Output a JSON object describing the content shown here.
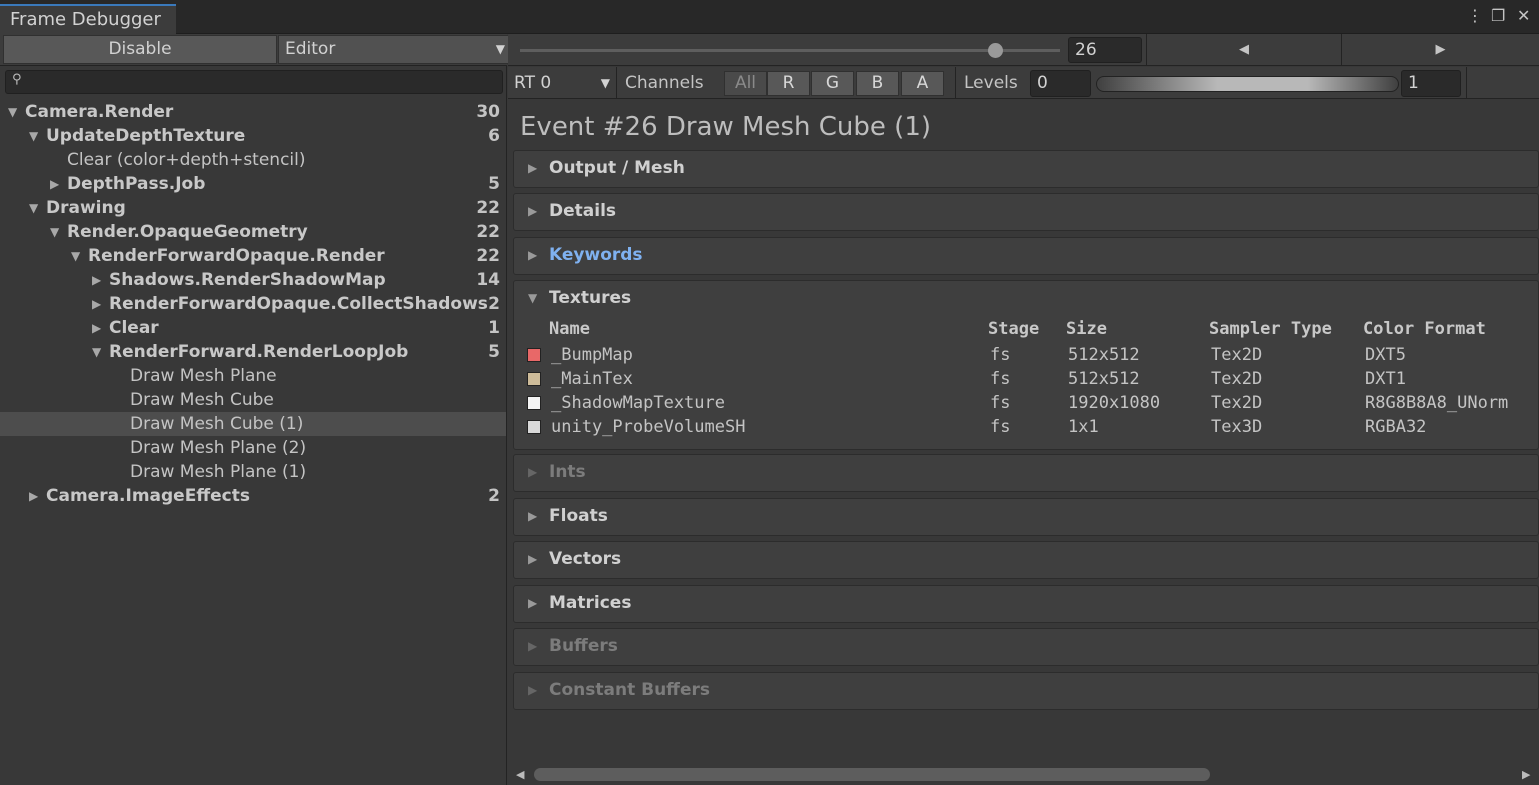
{
  "window": {
    "tab_title": "Frame Debugger",
    "icons": [
      "kebab-menu-icon",
      "maximize-icon",
      "close-icon"
    ],
    "menu_glyph": "⋮",
    "maximize_glyph": "❐",
    "close_glyph": "✕"
  },
  "left_toolbar": {
    "disable_label": "Disable",
    "target_label": "Editor"
  },
  "search": {
    "value": "",
    "icon": "search-icon"
  },
  "tree": [
    {
      "label": "Camera.Render",
      "count": "30",
      "depth": 0,
      "expanded": true,
      "bold": true
    },
    {
      "label": "UpdateDepthTexture",
      "count": "6",
      "depth": 1,
      "expanded": true,
      "bold": true
    },
    {
      "label": "Clear (color+depth+stencil)",
      "count": "",
      "depth": 2,
      "leaf": true
    },
    {
      "label": "DepthPass.Job",
      "count": "5",
      "depth": 2,
      "expanded": false,
      "bold": true
    },
    {
      "label": "Drawing",
      "count": "22",
      "depth": 1,
      "expanded": true,
      "bold": true
    },
    {
      "label": "Render.OpaqueGeometry",
      "count": "22",
      "depth": 2,
      "expanded": true,
      "bold": true
    },
    {
      "label": "RenderForwardOpaque.Render",
      "count": "22",
      "depth": 3,
      "expanded": true,
      "bold": true
    },
    {
      "label": "Shadows.RenderShadowMap",
      "count": "14",
      "depth": 4,
      "expanded": false,
      "bold": true
    },
    {
      "label": "RenderForwardOpaque.CollectShadows",
      "count": "2",
      "depth": 4,
      "expanded": false,
      "bold": true
    },
    {
      "label": "Clear",
      "count": "1",
      "depth": 4,
      "expanded": false,
      "bold": true
    },
    {
      "label": "RenderForward.RenderLoopJob",
      "count": "5",
      "depth": 4,
      "expanded": true,
      "bold": true
    },
    {
      "label": "Draw Mesh Plane",
      "count": "",
      "depth": 5,
      "leaf": true
    },
    {
      "label": "Draw Mesh Cube",
      "count": "",
      "depth": 5,
      "leaf": true
    },
    {
      "label": "Draw Mesh Cube (1)",
      "count": "",
      "depth": 5,
      "leaf": true,
      "selected": true
    },
    {
      "label": "Draw Mesh Plane (2)",
      "count": "",
      "depth": 5,
      "leaf": true
    },
    {
      "label": "Draw Mesh Plane (1)",
      "count": "",
      "depth": 5,
      "leaf": true
    },
    {
      "label": "Camera.ImageEffects",
      "count": "2",
      "depth": 1,
      "expanded": false,
      "bold": true
    }
  ],
  "event_nav": {
    "event_index": "26",
    "slider_fraction": 0.88,
    "prev_icon": "prev-event-icon",
    "next_icon": "next-event-icon"
  },
  "render_target": {
    "rt_label": "RT 0",
    "channels_label": "Channels",
    "channels": [
      "All",
      "R",
      "G",
      "B",
      "A"
    ],
    "levels_label": "Levels",
    "level_min": "0",
    "level_max": "1"
  },
  "event_title": "Event #26 Draw Mesh Cube (1)",
  "sections": [
    {
      "title": "Output / Mesh",
      "state": "normal"
    },
    {
      "title": "Details",
      "state": "normal"
    },
    {
      "title": "Keywords",
      "state": "link"
    }
  ],
  "textures": {
    "title": "Textures",
    "headers": [
      "Name",
      "Stage",
      "Size",
      "Sampler Type",
      "Color Format"
    ],
    "rows": [
      {
        "name": "_BumpMap",
        "stage": "fs",
        "size": "512x512",
        "sampler": "Tex2D",
        "format": "DXT5",
        "swatch": "#e86868"
      },
      {
        "name": "_MainTex",
        "stage": "fs",
        "size": "512x512",
        "sampler": "Tex2D",
        "format": "DXT1",
        "swatch": "#cdbb99"
      },
      {
        "name": "_ShadowMapTexture",
        "stage": "fs",
        "size": "1920x1080",
        "sampler": "Tex2D",
        "format": "R8G8B8A8_UNorm",
        "swatch": "#f4f4f4"
      },
      {
        "name": "unity_ProbeVolumeSH",
        "stage": "fs",
        "size": "1x1",
        "sampler": "Tex3D",
        "format": "RGBA32",
        "swatch": "#d8d8d8"
      }
    ]
  },
  "lower_sections": [
    {
      "title": "Ints",
      "state": "dim"
    },
    {
      "title": "Floats",
      "state": "normal"
    },
    {
      "title": "Vectors",
      "state": "normal"
    },
    {
      "title": "Matrices",
      "state": "normal"
    },
    {
      "title": "Buffers",
      "state": "dim"
    },
    {
      "title": "Constant Buffers",
      "state": "dim"
    }
  ]
}
